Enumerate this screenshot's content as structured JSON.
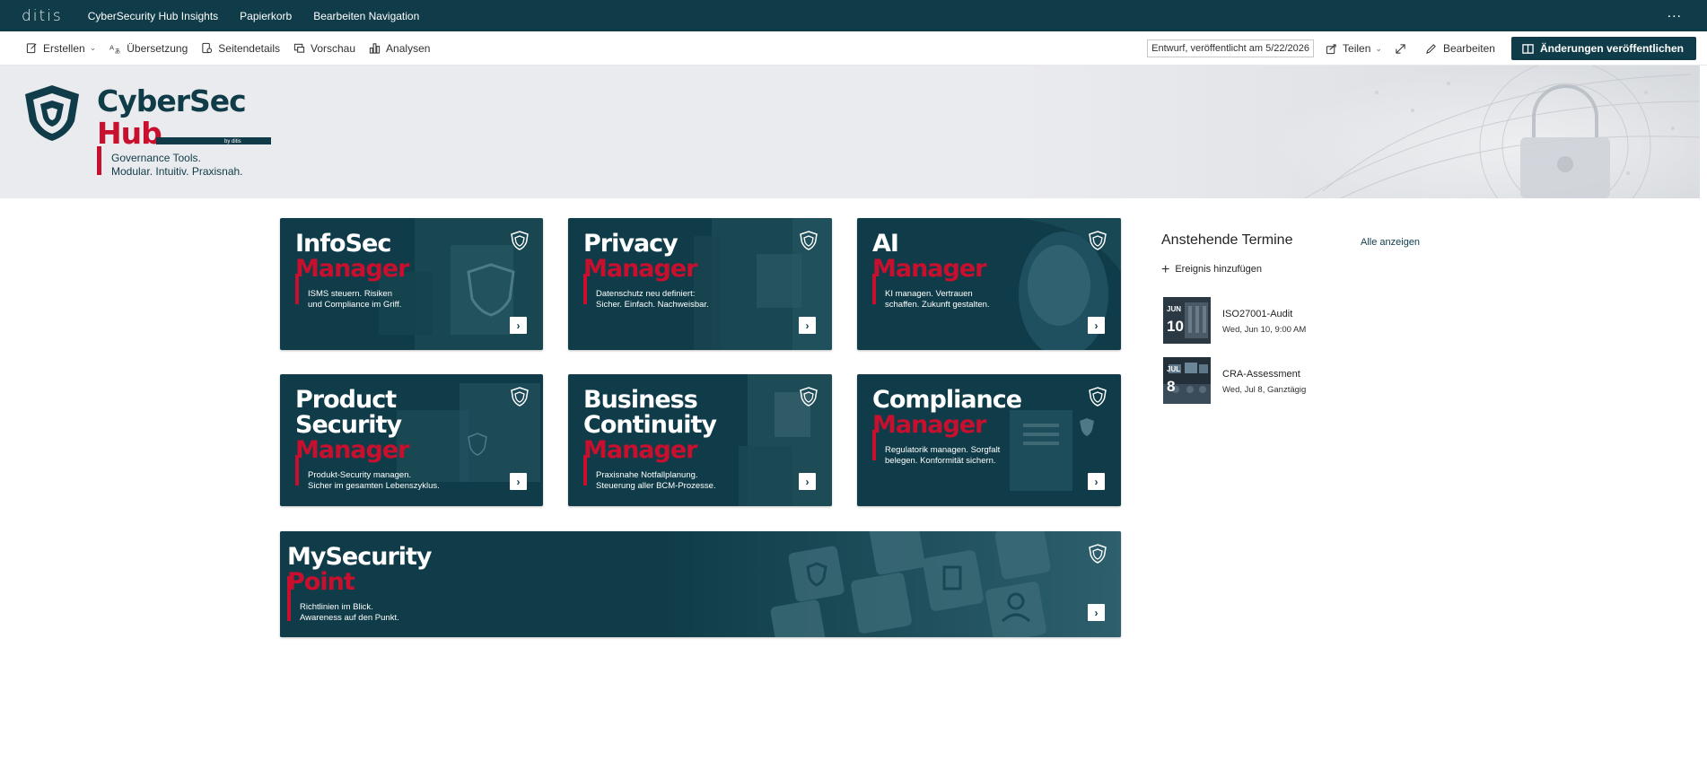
{
  "topnav": {
    "brand": "ditis",
    "links": [
      "CyberSecurity Hub Insights",
      "Papierkorb",
      "Bearbeiten Navigation"
    ],
    "more": "..."
  },
  "cmdbar": {
    "create": "Erstellen",
    "translation": "Übersetzung",
    "page_details": "Seitendetails",
    "preview": "Vorschau",
    "analytics": "Analysen",
    "status": "Entwurf, veröffentlicht am 5/22/2026",
    "share": "Teilen",
    "edit": "Bearbeiten",
    "publish": "Änderungen veröffentlichen"
  },
  "hero": {
    "logo_title": "CyberSec",
    "logo_hub": "Hub",
    "logo_by": "by ditis",
    "tagline_1": "Governance Tools.",
    "tagline_2": "Modular. Intuitiv. Praxisnah."
  },
  "tiles": [
    {
      "title1": "InfoSec",
      "title2": "",
      "accent": "Manager",
      "desc1": "ISMS steuern. Risiken",
      "desc2": "und Compliance im Griff."
    },
    {
      "title1": "Privacy",
      "title2": "",
      "accent": "Manager",
      "desc1": "Datenschutz neu definiert:",
      "desc2": "Sicher. Einfach. Nachweisbar."
    },
    {
      "title1": "AI",
      "title2": "",
      "accent": "Manager",
      "desc1": "KI managen. Vertrauen",
      "desc2": "schaffen. Zukunft gestalten."
    },
    {
      "title1": "Product",
      "title2": "Security",
      "accent": "Manager",
      "desc1": "Produkt-Security managen.",
      "desc2": "Sicher im gesamten Lebenszyklus."
    },
    {
      "title1": "Business",
      "title2": "Continuity",
      "accent": "Manager",
      "desc1": "Praxisnahe Notfallplanung.",
      "desc2": "Steuerung aller BCM-Prozesse."
    },
    {
      "title1": "Compliance",
      "title2": "",
      "accent": "Manager",
      "desc1": "Regulatorik managen. Sorgfalt",
      "desc2": "belegen. Konformität sichern."
    },
    {
      "title1": "MySecurity",
      "title2": "",
      "accent": "Point",
      "desc1": "Richtlinien im Blick.",
      "desc2": "Awareness auf den Punkt."
    }
  ],
  "events": {
    "header": "Anstehende Termine",
    "see_all": "Alle anzeigen",
    "add": "Ereignis hinzufügen",
    "items": [
      {
        "month": "JUN",
        "day": "10",
        "name": "ISO27001-Audit",
        "time": "Wed, Jun 10, 9:00 AM"
      },
      {
        "month": "JUL",
        "day": "8",
        "name": "CRA-Assessment",
        "time": "Wed, Jul 8, Ganztägig"
      }
    ]
  },
  "colors": {
    "brand_teal": "#0f3c48",
    "brand_red": "#c8102e"
  }
}
